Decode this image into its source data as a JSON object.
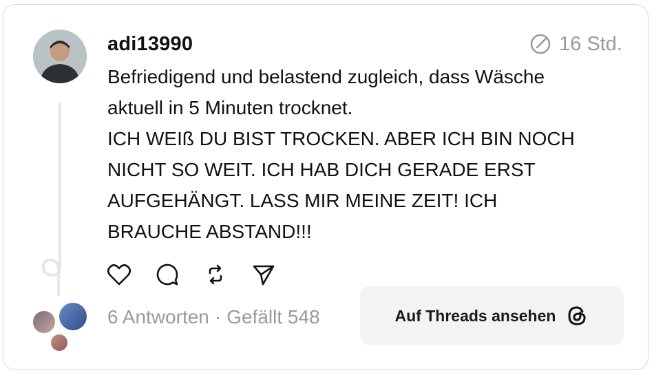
{
  "post": {
    "username": "adi13990",
    "timestamp": "16 Std.",
    "text_lines": [
      "Befriedigend und belastend zugleich, dass Wäsche",
      "aktuell in 5 Minuten trocknet.",
      "ICH WEIß DU BIST TROCKEN. ABER ICH BIN NOCH",
      "NICHT SO WEIT. ICH HAB DICH GERADE ERST",
      "AUFGEHÄNGT. LASS MIR MEINE ZEIT! ICH",
      "BRAUCHE ABSTAND!!!"
    ],
    "replies": "6 Antworten",
    "separator": "·",
    "likes": "Gefällt 548"
  },
  "actions": [
    "heart-icon",
    "comment-icon",
    "repost-icon",
    "share-icon"
  ],
  "cta": {
    "label": "Auf Threads ansehen",
    "icon": "threads-logo-icon"
  }
}
